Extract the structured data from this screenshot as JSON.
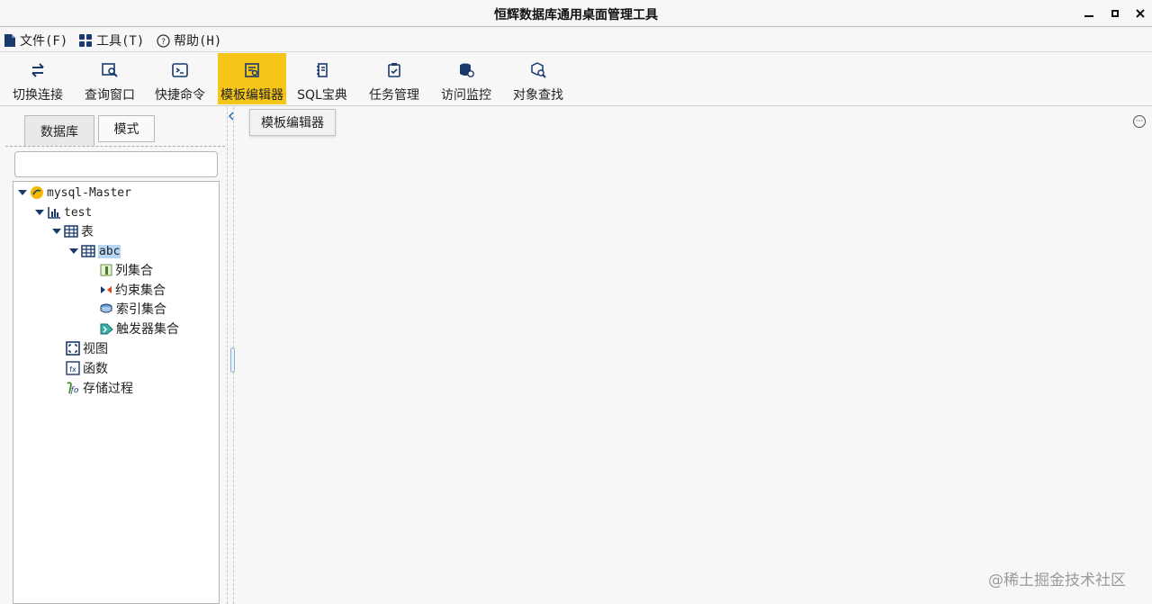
{
  "window": {
    "title": "恒辉数据库通用桌面管理工具"
  },
  "menu": [
    {
      "label": "文件(F)",
      "icon": "file-icon"
    },
    {
      "label": "工具(T)",
      "icon": "tools-icon"
    },
    {
      "label": "帮助(H)",
      "icon": "help-icon"
    }
  ],
  "toolbar": [
    {
      "label": "切换连接",
      "icon": "switch-connection-icon"
    },
    {
      "label": "查询窗口",
      "icon": "query-window-icon"
    },
    {
      "label": "快捷命令",
      "icon": "command-icon"
    },
    {
      "label": "模板编辑器",
      "icon": "template-editor-icon",
      "active": true
    },
    {
      "label": "SQL宝典",
      "icon": "sql-book-icon"
    },
    {
      "label": "任务管理",
      "icon": "task-icon"
    },
    {
      "label": "访问监控",
      "icon": "monitor-icon"
    },
    {
      "label": "对象查找",
      "icon": "object-search-icon"
    }
  ],
  "left_tabs": [
    {
      "label": "数据库",
      "selected": true
    },
    {
      "label": "模式",
      "selected": false
    }
  ],
  "search": {
    "value": ""
  },
  "tree": {
    "connection": "mysql-Master",
    "database": "test",
    "tables_folder": "表",
    "table": "abc",
    "columns": "列集合",
    "constraints": "约束集合",
    "indexes": "索引集合",
    "triggers": "触发器集合",
    "views": "视图",
    "functions": "函数",
    "procedures": "存储过程"
  },
  "editor": {
    "tab_label": "模板编辑器"
  },
  "watermark": "@稀土掘金技术社区",
  "colors": {
    "accent": "#f5c518",
    "icon_blue": "#1a3a6e",
    "selection": "#b6d6f5"
  }
}
